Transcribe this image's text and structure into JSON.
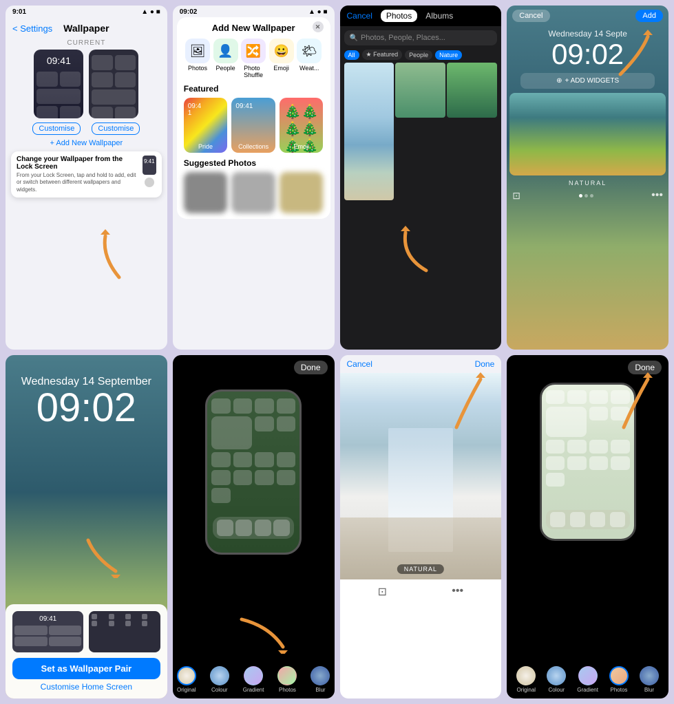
{
  "grid": {
    "cells": [
      {
        "id": "cell1",
        "statusTime": "9:01",
        "backLabel": "< Settings",
        "title": "Wallpaper",
        "currentLabel": "CURRENT",
        "lockTime": "09:41",
        "customiseLabel1": "Customise",
        "customiseLabel2": "Customise",
        "addNewLabel": "+ Add New Wallpaper",
        "tooltipTitle": "Change your Wallpaper from the Lock Screen",
        "tooltipBody": "From your Lock Screen, tap and hold to add, edit or switch between different wallpapers and widgets.",
        "tooltipTime": "9:41"
      },
      {
        "id": "cell2",
        "statusTime": "09:02",
        "sheetTitle": "Add New Wallpaper",
        "icons": [
          "Photos",
          "People",
          "Photo Shuffle",
          "Emoji",
          "Weather"
        ],
        "featuredLabel": "Featured",
        "items": [
          "Pride",
          "Collections",
          "Emoji"
        ],
        "suggestedLabel": "Suggested Photos"
      },
      {
        "id": "cell3",
        "cancelLabel": "Cancel",
        "photosTab": "Photos",
        "albumsTab": "Albums",
        "searchPlaceholder": "Photos, People, Places...",
        "filterAll": "All",
        "filterFeatured": "★ Featured",
        "filterPeople": "People",
        "filterNature": "Nature"
      },
      {
        "id": "cell4",
        "cancelLabel": "Cancel",
        "addLabel": "Add",
        "dateLabel": "Wednesday 14 Septe",
        "timeLabel": "09:02",
        "addWidgetsLabel": "+ ADD WIDGETS",
        "naturalLabel": "NATURAL"
      },
      {
        "id": "cell5",
        "dateLabel": "Wednesday 14 September",
        "timeLabel": "09:02",
        "setWallpaperLabel": "Set as Wallpaper Pair",
        "customiseLabel": "Customise Home Screen",
        "lockTime": "09:41"
      },
      {
        "id": "cell6",
        "doneLabel": "Done",
        "styleLabels": [
          "Original",
          "Colour",
          "Gradient",
          "Photos",
          "Blur"
        ]
      },
      {
        "id": "cell7",
        "cancelLabel": "Cancel",
        "doneLabel": "Done",
        "naturalBadge": "NATURAL"
      },
      {
        "id": "cell8",
        "doneLabel": "Done",
        "styleLabels": [
          "Original",
          "Colour",
          "Gradient",
          "Photos",
          "Blur"
        ]
      }
    ]
  }
}
